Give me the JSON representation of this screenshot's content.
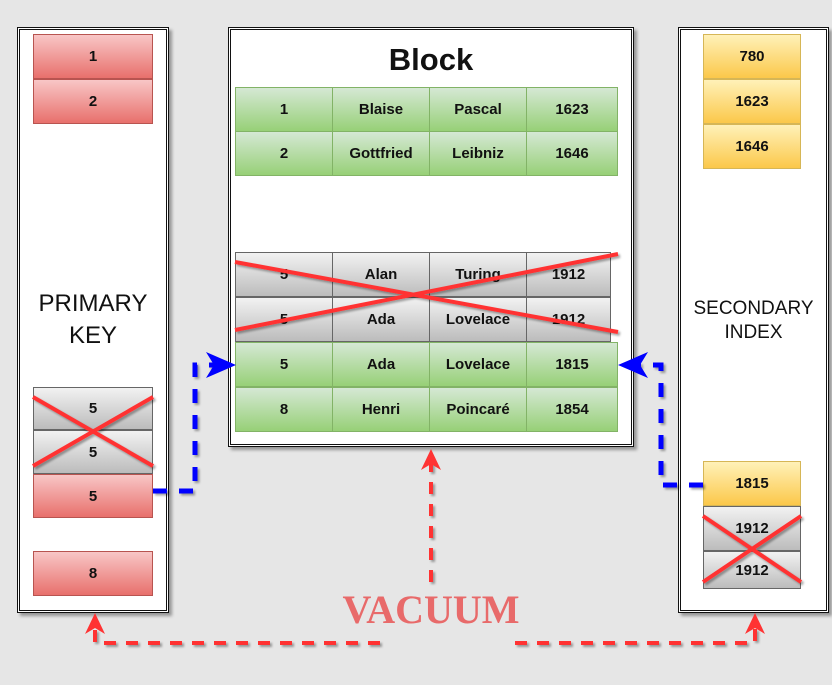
{
  "primary_key": {
    "label_line1": "PRIMARY",
    "label_line2": "KEY",
    "cells": [
      {
        "value": "1",
        "state": "live"
      },
      {
        "value": "2",
        "state": "live"
      },
      {
        "value": "5",
        "state": "deleted"
      },
      {
        "value": "5",
        "state": "deleted"
      },
      {
        "value": "5",
        "state": "live"
      },
      {
        "value": "8",
        "state": "live"
      }
    ]
  },
  "block": {
    "title": "Block",
    "rows": [
      {
        "state": "live",
        "cells": [
          "1",
          "Blaise",
          "Pascal",
          "1623"
        ]
      },
      {
        "state": "live",
        "cells": [
          "2",
          "Gottfried",
          "Leibniz",
          "1646"
        ]
      },
      {
        "state": "deleted",
        "cells": [
          "5",
          "Alan",
          "Turing",
          "1912"
        ]
      },
      {
        "state": "deleted",
        "cells": [
          "5",
          "Ada",
          "Lovelace",
          "1912"
        ]
      },
      {
        "state": "live",
        "cells": [
          "5",
          "Ada",
          "Lovelace",
          "1815"
        ]
      },
      {
        "state": "live",
        "cells": [
          "8",
          "Henri",
          "Poincaré",
          "1854"
        ]
      }
    ]
  },
  "secondary_index": {
    "label_line1": "SECONDARY",
    "label_line2": "INDEX",
    "cells": [
      {
        "value": "780",
        "state": "live"
      },
      {
        "value": "1623",
        "state": "live"
      },
      {
        "value": "1646",
        "state": "live"
      },
      {
        "value": "1815",
        "state": "live"
      },
      {
        "value": "1912",
        "state": "deleted"
      },
      {
        "value": "1912",
        "state": "deleted"
      }
    ]
  },
  "vacuum_label": "VACUUM",
  "colors": {
    "pointer": "#0000ff",
    "vacuum": "#ff3333",
    "vacuum_text": "#e86a6a",
    "cross": "#ff3333"
  }
}
